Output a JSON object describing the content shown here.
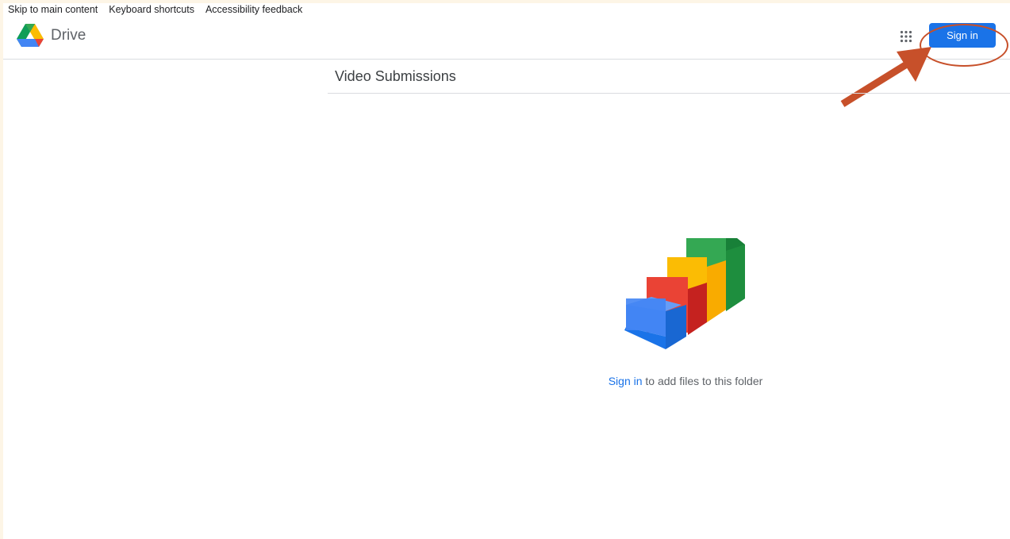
{
  "skip_links": {
    "main": "Skip to main content",
    "shortcuts": "Keyboard shortcuts",
    "feedback": "Accessibility feedback"
  },
  "header": {
    "app_name": "Drive",
    "signin_label": "Sign in"
  },
  "folder": {
    "title": "Video Submissions"
  },
  "empty_state": {
    "link_text": "Sign in",
    "message": " to add files to this folder"
  },
  "colors": {
    "accent": "#1a73e8",
    "annotation": "#c7502a"
  },
  "icons": {
    "logo": "google-drive-icon",
    "apps": "apps-grid-icon"
  }
}
